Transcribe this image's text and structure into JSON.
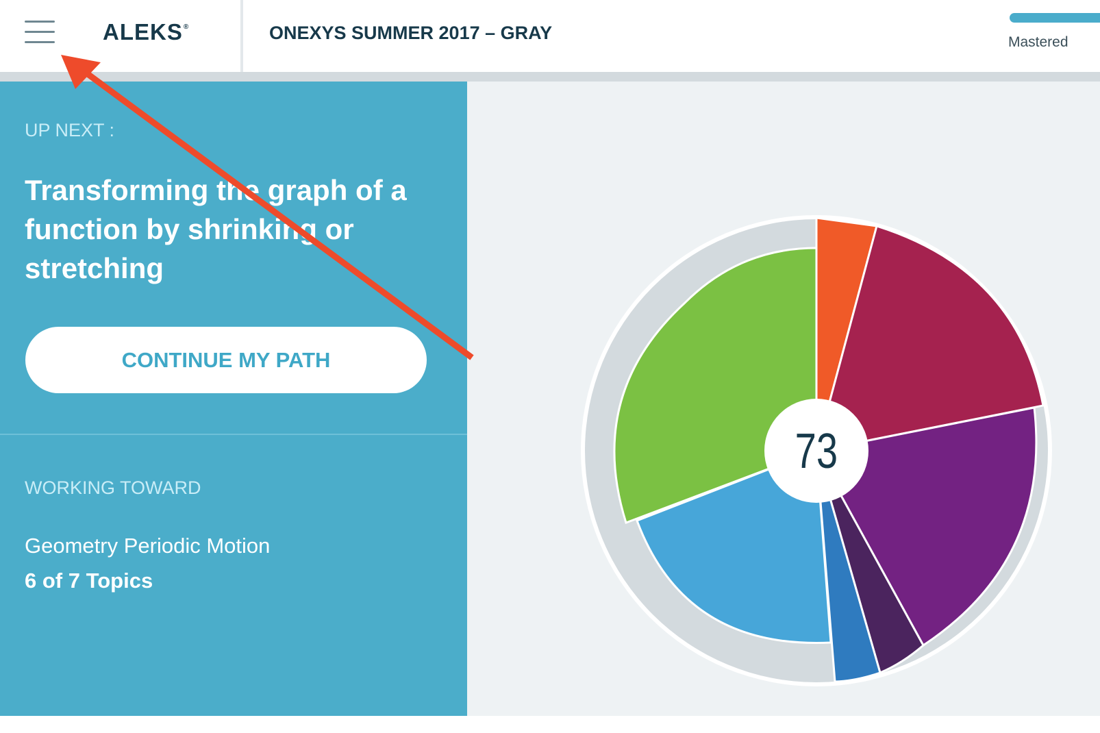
{
  "header": {
    "menu_icon": "hamburger-menu-icon",
    "logo": "ALEKS",
    "logo_mark": "®",
    "class_title": "ONEXYS SUMMER 2017 – GRAY",
    "mastered_label": "Mastered"
  },
  "up_next": {
    "label": "UP NEXT :",
    "topic": "Transforming the graph of a function by shrinking or stretching",
    "button": "CONTINUE MY PATH"
  },
  "working_toward": {
    "label": "WORKING TOWARD",
    "goal": "Geometry Periodic Motion",
    "progress": "6 of 7 Topics"
  },
  "pie": {
    "center_value": "73",
    "colors": {
      "ring": "#d3dade",
      "ring_edge": "#ffffff",
      "slice_orange": "#f05a28",
      "slice_crimson": "#a5224f",
      "slice_purple": "#732282",
      "slice_dark_purple": "#4b245e",
      "slice_dark_blue": "#2f7bbf",
      "slice_light_blue": "#47a6d9",
      "slice_green": "#7bc143"
    }
  },
  "annotation": {
    "arrow_color": "#ee4b2b"
  }
}
